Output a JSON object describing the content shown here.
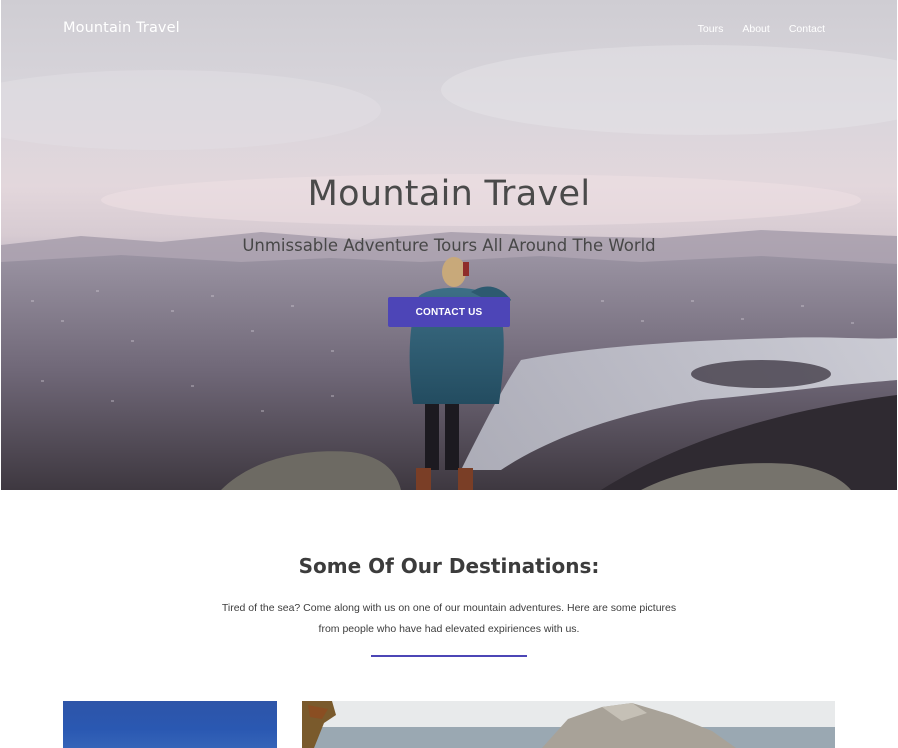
{
  "nav": {
    "brand": "Mountain Travel",
    "links": [
      "Tours",
      "About",
      "Contact"
    ]
  },
  "hero": {
    "title": "Mountain Travel",
    "subtitle": "Unmissable Adventure Tours All Around The World",
    "cta_label": "CONTACT US"
  },
  "destinations": {
    "title": "Some Of Our Destinations:",
    "description": "Tired of the sea? Come along with us on one of our mountain adventures. Here are some pictures from people who have had elevated expiriences with us."
  },
  "colors": {
    "accent": "#4d45b7",
    "hero_title": "#4a4a4a",
    "text": "#3d3d3d"
  }
}
